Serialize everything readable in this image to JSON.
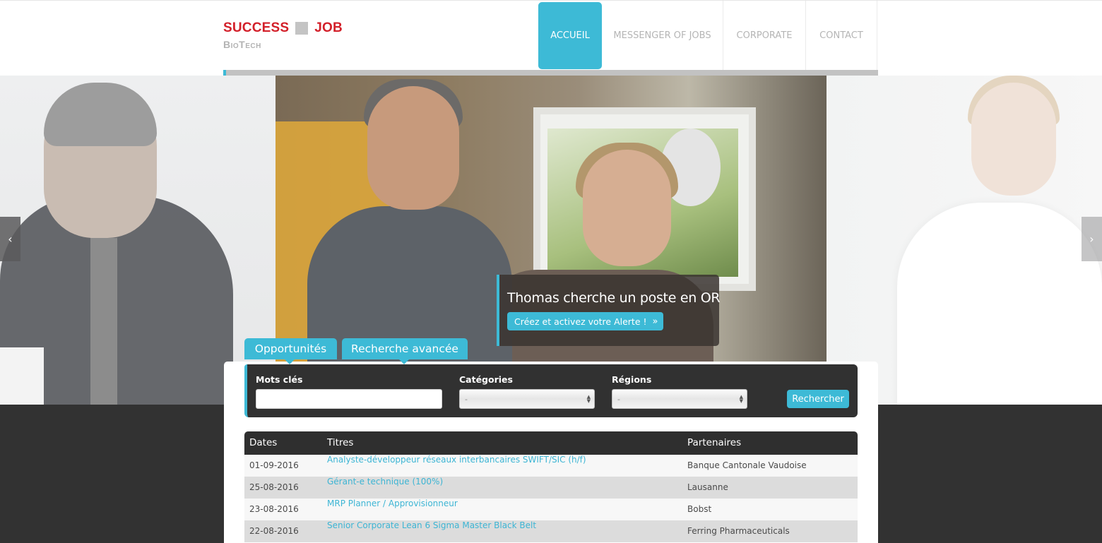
{
  "header": {
    "logo": {
      "word1": "SUCCESS",
      "word2": "JOB",
      "subtitle": "BioTech"
    },
    "nav": [
      {
        "label": "ACCUEIL",
        "active": true
      },
      {
        "label": "MESSENGER OF JOBS",
        "active": false
      },
      {
        "label": "CORPORATE",
        "active": false
      },
      {
        "label": "CONTACT",
        "active": false
      }
    ]
  },
  "hero": {
    "caption_title": "Thomas cherche un poste en OR",
    "caption_button": "Créez et activez votre Alerte !",
    "caption_button_icon": "double-chevron-right-icon",
    "prev_icon": "chevron-left-icon",
    "next_icon": "chevron-right-icon"
  },
  "search": {
    "tabs": [
      {
        "label": "Opportunités"
      },
      {
        "label": "Recherche avancée"
      }
    ],
    "keywords_label": "Mots clés",
    "keywords_value": "",
    "categories_label": "Catégories",
    "categories_selected": "-",
    "regions_label": "Régions",
    "regions_selected": "-",
    "submit_label": "Rechercher"
  },
  "jobs": {
    "columns": [
      "Dates",
      "Titres",
      "Partenaires"
    ],
    "rows": [
      {
        "date": "01-09-2016",
        "title": "Analyste-développeur réseaux interbancaires SWIFT/SIC (h/f)",
        "partner": "Banque Cantonale Vaudoise"
      },
      {
        "date": "25-08-2016",
        "title": "Gérant-e technique (100%)",
        "partner": "Lausanne"
      },
      {
        "date": "23-08-2016",
        "title": "MRP Planner / Approvisionneur",
        "partner": "Bobst"
      },
      {
        "date": "22-08-2016",
        "title": "Senior Corporate Lean 6 Sigma Master Black Belt",
        "partner": "Ferring Pharmaceuticals"
      }
    ]
  },
  "colors": {
    "accent": "#3dbad6",
    "logo_red": "#d3202a",
    "dark": "#313131"
  }
}
